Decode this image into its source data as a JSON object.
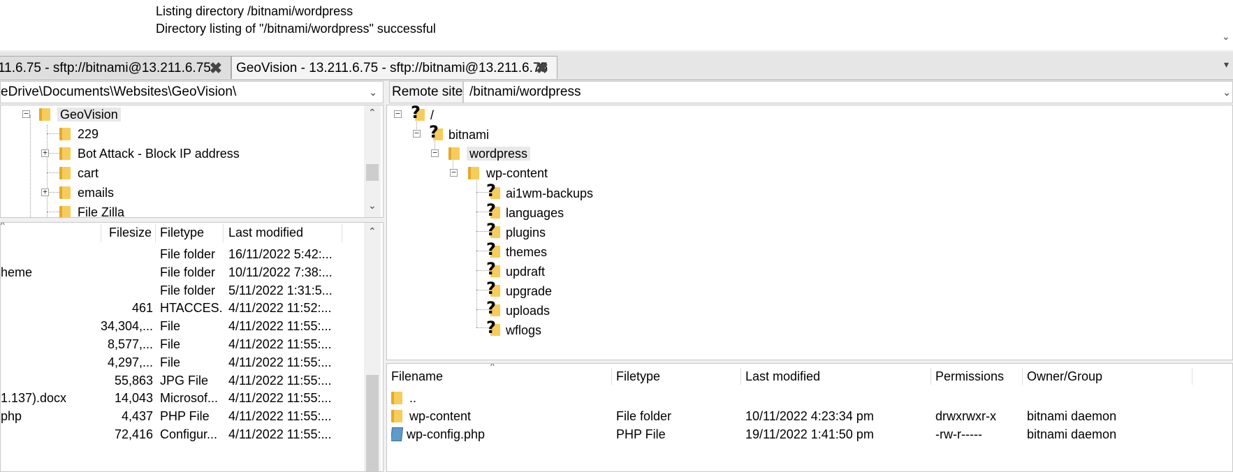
{
  "log": {
    "lines": [
      "Listing directory /bitnami/wordpress",
      "Directory listing of \"/bitnami/wordpress\" successful"
    ]
  },
  "tabs": [
    {
      "label": "11.6.75 - sftp://bitnami@13.211.6.75",
      "close": "✖"
    },
    {
      "label": "GeoVision - 13.211.6.75 - sftp://bitnami@13.211.6.75",
      "close": "✖"
    }
  ],
  "local": {
    "path": "eDrive\\Documents\\Websites\\GeoVision\\",
    "tree": [
      "GeoVision",
      "229",
      "Bot Attack - Block IP address",
      "cart",
      "emails",
      "File Zilla"
    ],
    "columns": [
      "Filesize",
      "Filetype",
      "Last modified"
    ],
    "rows": [
      {
        "name": "",
        "size": "",
        "type": "File folder",
        "modified": "16/11/2022 5:42:..."
      },
      {
        "name": "heme",
        "size": "",
        "type": "File folder",
        "modified": "10/11/2022 7:38:..."
      },
      {
        "name": "",
        "size": "",
        "type": "File folder",
        "modified": "5/11/2022 1:31:5..."
      },
      {
        "name": "",
        "size": "461",
        "type": "HTACCES...",
        "modified": "4/11/2022 11:52:..."
      },
      {
        "name": "",
        "size": "34,304,...",
        "type": "File",
        "modified": "4/11/2022 11:55:..."
      },
      {
        "name": "",
        "size": "8,577,...",
        "type": "File",
        "modified": "4/11/2022 11:55:..."
      },
      {
        "name": "",
        "size": "4,297,...",
        "type": "File",
        "modified": "4/11/2022 11:55:..."
      },
      {
        "name": "",
        "size": "55,863",
        "type": "JPG File",
        "modified": "4/11/2022 11:55:..."
      },
      {
        "name": "1.137).docx",
        "size": "14,043",
        "type": "Microsof...",
        "modified": "4/11/2022 11:55:..."
      },
      {
        "name": "php",
        "size": "4,437",
        "type": "PHP File",
        "modified": "4/11/2022 11:55:..."
      },
      {
        "name": "",
        "size": "72,416",
        "type": "Configur...",
        "modified": "4/11/2022 11:55:..."
      }
    ]
  },
  "remote": {
    "label": "Remote site:",
    "path": "/bitnami/wordpress",
    "tree": {
      "root": "/",
      "bitnami": "bitnami",
      "wordpress": "wordpress",
      "wp_content": "wp-content",
      "children": [
        "ai1wm-backups",
        "languages",
        "plugins",
        "themes",
        "updraft",
        "upgrade",
        "uploads",
        "wflogs"
      ]
    },
    "columns": [
      "Filename",
      "Filetype",
      "Last modified",
      "Permissions",
      "Owner/Group"
    ],
    "rows": [
      {
        "name": "..",
        "type": "",
        "modified": "",
        "perms": "",
        "owner": "",
        "icon": "folder-icon"
      },
      {
        "name": "wp-content",
        "type": "File folder",
        "modified": "10/11/2022 4:23:34 pm",
        "perms": "drwxrwxr-x",
        "owner": "bitnami daemon",
        "icon": "folder-icon"
      },
      {
        "name": "wp-config.php",
        "type": "PHP File",
        "modified": "19/11/2022 1:41:50 pm",
        "perms": "-rw-r-----",
        "owner": "bitnami daemon",
        "icon": "php-file-icon"
      }
    ]
  },
  "colors": {
    "folder": "#f7cc5b",
    "selection": "#e8e8e8"
  }
}
